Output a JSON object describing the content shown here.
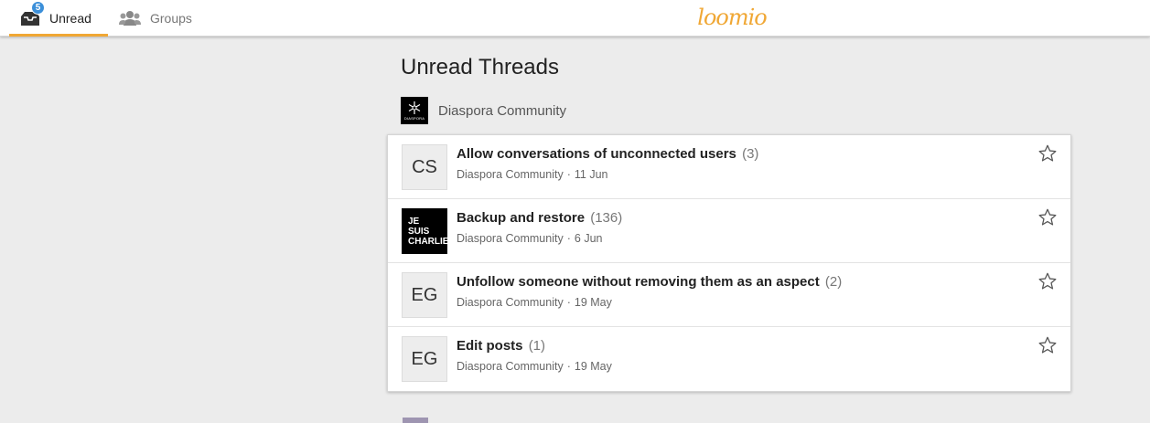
{
  "nav": {
    "unread_label": "Unread",
    "unread_badge": "5",
    "groups_label": "Groups",
    "logo_text": "loomio",
    "accent_color": "#f0a734"
  },
  "main": {
    "title": "Unread Threads",
    "group": {
      "name": "Diaspora Community",
      "logo_caption": "DIASPORA"
    },
    "threads": [
      {
        "avatar": "CS",
        "title": "Allow conversations of unconnected users",
        "count": "(3)",
        "group": "Diaspora Community",
        "sep": "·",
        "date": "11 Jun"
      },
      {
        "avatar_line1": "JE SUIS",
        "avatar_line2": "CHARLIE",
        "title": "Backup and restore",
        "count": "(136)",
        "group": "Diaspora Community",
        "sep": "·",
        "date": "6 Jun"
      },
      {
        "avatar": "EG",
        "title": "Unfollow someone without removing them as an aspect",
        "count": "(2)",
        "group": "Diaspora Community",
        "sep": "·",
        "date": "19 May"
      },
      {
        "avatar": "EG",
        "title": "Edit posts",
        "count": "(1)",
        "group": "Diaspora Community",
        "sep": "·",
        "date": "19 May"
      }
    ]
  }
}
